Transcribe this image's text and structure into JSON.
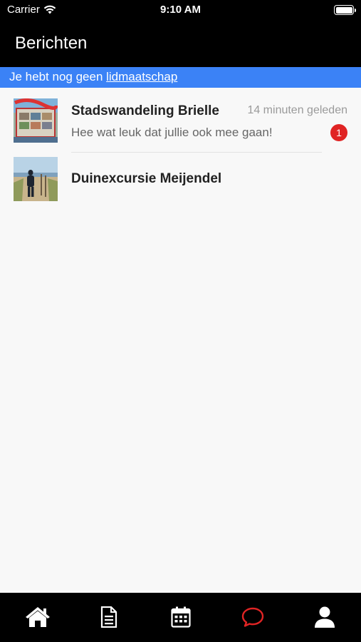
{
  "status_bar": {
    "carrier": "Carrier",
    "time": "9:10 AM"
  },
  "header": {
    "title": "Berichten"
  },
  "banner": {
    "text": "Je hebt nog geen ",
    "link": "lidmaatschap",
    "color": "#3b82f6"
  },
  "conversations": [
    {
      "title": "Stadswandeling Brielle",
      "time": "14 minuten geleden",
      "preview": "Hee wat leuk dat jullie ook mee gaan!",
      "unread": "1",
      "thumbnail": "city-walk-collage-image"
    },
    {
      "title": "Duinexcursie Meijendel",
      "thumbnail": "dune-beach-path-image"
    }
  ],
  "tab_bar": {
    "tabs": [
      {
        "icon": "home-icon",
        "active": false
      },
      {
        "icon": "document-icon",
        "active": false
      },
      {
        "icon": "calendar-icon",
        "active": false
      },
      {
        "icon": "chat-bubble-icon",
        "active": true
      },
      {
        "icon": "profile-icon",
        "active": false
      }
    ],
    "active_color": "#e02424",
    "inactive_color": "#ffffff"
  }
}
